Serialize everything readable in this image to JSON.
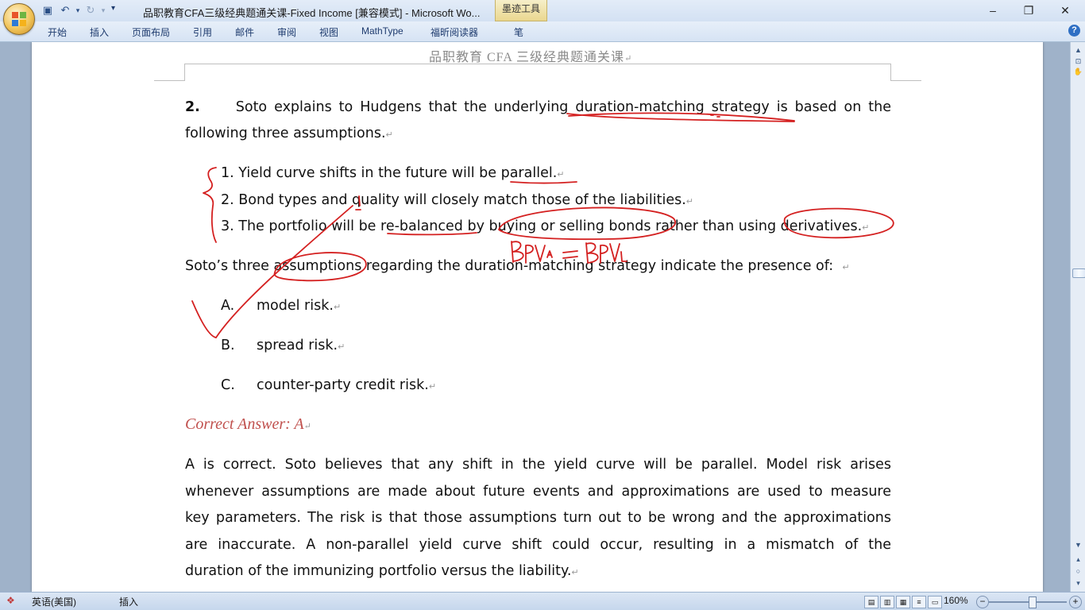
{
  "window": {
    "title": "品职教育CFA三级经典题通关课-Fixed Income [兼容模式] - Microsoft Wo...",
    "contextual_tab": "墨迹工具",
    "minimize": "–",
    "restore": "❐",
    "close": "✕"
  },
  "qat": {
    "dropdown": "▾"
  },
  "ribbon": {
    "tabs": [
      "开始",
      "插入",
      "页面布局",
      "引用",
      "邮件",
      "审阅",
      "视图",
      "MathType",
      "福昕阅读器",
      "笔"
    ],
    "help": "?"
  },
  "page": {
    "header": "品职教育  CFA 三级经典题通关课",
    "question_number": "2.",
    "question_line1": "Soto explains to Hudgens that the underlying duration-matching strategy is based on the",
    "question_line2": "following three assumptions.",
    "assumptions": [
      "1. Yield curve shifts in the future will be parallel.",
      "2. Bond types and quality will closely match those of the liabilities.",
      "3. The portfolio will be re-balanced by buying or selling bonds rather than using derivatives."
    ],
    "prompt": "Soto’s three assumptions regarding the duration-matching strategy indicate the presence of:",
    "options": [
      {
        "letter": "A.",
        "text": "model risk."
      },
      {
        "letter": "B.",
        "text": "spread risk."
      },
      {
        "letter": "C.",
        "text": "counter-party credit risk."
      }
    ],
    "answer": "Correct Answer: A",
    "explanation": [
      "A is correct. Soto believes that any shift in the yield curve will be parallel. Model risk arises",
      "whenever assumptions are made about future events and approximations are used to measure",
      "key parameters. The risk is that those assumptions turn out to be wrong and the approximations",
      "are inaccurate. A non-parallel yield curve shift could occur, resulting in a mismatch of the",
      "duration of the immunizing portfolio versus the liability."
    ],
    "ink_note": "BPVA = BPVL"
  },
  "status": {
    "language": "英语(美国)",
    "mode": "插入",
    "zoom": "160%",
    "zoom_out": "−",
    "zoom_in": "+"
  },
  "colors": {
    "ink": "#d42020",
    "answer": "#c0504d",
    "workspace": "#9fb2c9"
  }
}
